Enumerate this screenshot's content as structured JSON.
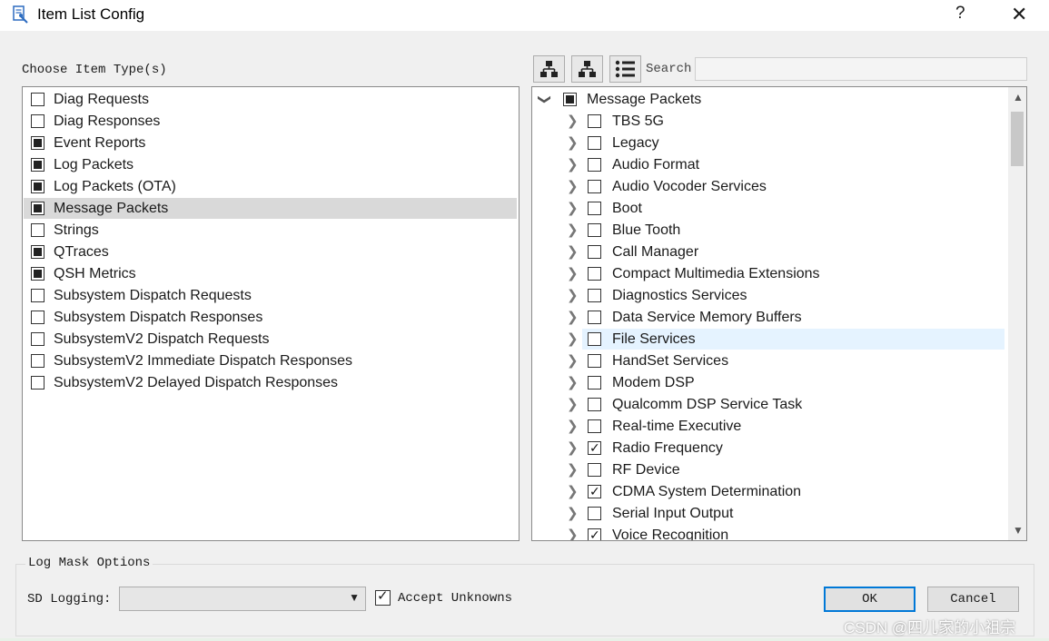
{
  "window": {
    "title": "Item List Config",
    "help_label": "?",
    "close_label": "✕"
  },
  "left": {
    "section_label": "Choose Item Type(s)",
    "items": [
      {
        "label": "Diag Requests",
        "state": "unchecked"
      },
      {
        "label": "Diag Responses",
        "state": "unchecked"
      },
      {
        "label": "Event Reports",
        "state": "partial"
      },
      {
        "label": "Log Packets",
        "state": "partial"
      },
      {
        "label": "Log Packets (OTA)",
        "state": "partial"
      },
      {
        "label": "Message Packets",
        "state": "partial",
        "selected": true
      },
      {
        "label": "Strings",
        "state": "unchecked"
      },
      {
        "label": "QTraces",
        "state": "partial"
      },
      {
        "label": "QSH Metrics",
        "state": "partial"
      },
      {
        "label": "Subsystem Dispatch Requests",
        "state": "unchecked"
      },
      {
        "label": "Subsystem Dispatch Responses",
        "state": "unchecked"
      },
      {
        "label": "SubsystemV2 Dispatch Requests",
        "state": "unchecked"
      },
      {
        "label": "SubsystemV2 Immediate Dispatch Responses",
        "state": "unchecked"
      },
      {
        "label": "SubsystemV2 Delayed Dispatch Responses",
        "state": "unchecked"
      }
    ]
  },
  "right": {
    "toolbar": {
      "buttons": [
        "expand-tree-icon",
        "collapse-tree-icon",
        "list-view-icon"
      ],
      "search_label": "Search",
      "search_value": ""
    },
    "tree": {
      "root": {
        "label": "Message Packets",
        "state": "partial",
        "expanded": true
      },
      "children": [
        {
          "label": "TBS 5G",
          "state": "unchecked"
        },
        {
          "label": "Legacy",
          "state": "unchecked"
        },
        {
          "label": "Audio Format",
          "state": "unchecked"
        },
        {
          "label": "Audio Vocoder Services",
          "state": "unchecked"
        },
        {
          "label": "Boot",
          "state": "unchecked"
        },
        {
          "label": "Blue Tooth",
          "state": "unchecked"
        },
        {
          "label": "Call Manager",
          "state": "unchecked"
        },
        {
          "label": "Compact Multimedia Extensions",
          "state": "unchecked"
        },
        {
          "label": "Diagnostics Services",
          "state": "unchecked"
        },
        {
          "label": "Data Service Memory Buffers",
          "state": "unchecked"
        },
        {
          "label": "File Services",
          "state": "unchecked",
          "hover": true
        },
        {
          "label": "HandSet Services",
          "state": "unchecked"
        },
        {
          "label": "Modem DSP",
          "state": "unchecked"
        },
        {
          "label": "Qualcomm DSP Service Task",
          "state": "unchecked"
        },
        {
          "label": "Real-time Executive",
          "state": "unchecked"
        },
        {
          "label": "Radio Frequency",
          "state": "checked"
        },
        {
          "label": "RF Device",
          "state": "unchecked"
        },
        {
          "label": "CDMA System Determination",
          "state": "checked"
        },
        {
          "label": "Serial Input Output",
          "state": "unchecked"
        },
        {
          "label": "Voice Recognition",
          "state": "checked"
        }
      ]
    }
  },
  "bottom": {
    "group_title": "Log Mask Options",
    "sd_logging_label": "SD Logging:",
    "sd_logging_value": "",
    "accept_unknowns_label": "Accept Unknowns",
    "accept_unknowns_checked": true,
    "ok_label": "OK",
    "cancel_label": "Cancel"
  },
  "watermark": "CSDN @四儿家的小祖宗",
  "colors": {
    "accent": "#0078d7",
    "selection": "#d9d9d9",
    "hover": "#e5f3ff"
  }
}
